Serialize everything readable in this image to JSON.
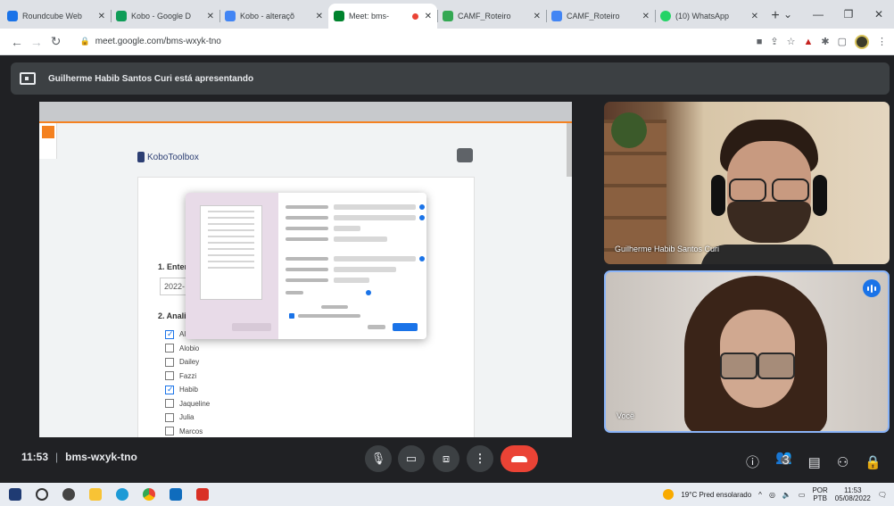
{
  "browser": {
    "tabs": [
      {
        "title": "Roundcube Web",
        "color": "#1a73e8",
        "active": false
      },
      {
        "title": "Kobo - Google D",
        "color": "#0f9d58",
        "active": false
      },
      {
        "title": "Kobo - alteraçõ",
        "color": "#4285f4",
        "active": false
      },
      {
        "title": "Meet: bms-",
        "color": "#00832d",
        "active": true
      },
      {
        "title": "CAMF_Roteiro",
        "color": "#34a853",
        "active": false
      },
      {
        "title": "CAMF_Roteiro",
        "color": "#4285f4",
        "active": false
      },
      {
        "title": "(10) WhatsApp",
        "color": "#25d366",
        "active": false
      }
    ],
    "url": "meet.google.com/bms-wxyk-tno"
  },
  "meet": {
    "presenting_text": "Guilherme Habib Santos Curi está apresentando",
    "time": "11:53",
    "separator": "|",
    "meeting_code": "bms-wxyk-tno",
    "participant_count": "3"
  },
  "shared_screen": {
    "logo_text": "KoboToolbox",
    "question1": "1. Enter",
    "field_value": "2022-",
    "question2": "2. Anali",
    "options": [
      {
        "label": "Al",
        "checked": true
      },
      {
        "label": "Alobio",
        "checked": false
      },
      {
        "label": "Dailey",
        "checked": false
      },
      {
        "label": "Fazzi",
        "checked": false
      },
      {
        "label": "Habib",
        "checked": true
      },
      {
        "label": "Jaqueline",
        "checked": false
      },
      {
        "label": "Julia",
        "checked": false
      },
      {
        "label": "Marcos",
        "checked": false
      }
    ]
  },
  "participants": [
    {
      "name": "Guilherme Habib Santos Curi"
    },
    {
      "name": "Você"
    }
  ],
  "taskbar": {
    "weather": "19°C Pred ensolarado",
    "lang1": "POR",
    "lang2": "PTB",
    "clock_time": "11:53",
    "clock_date": "05/08/2022"
  }
}
